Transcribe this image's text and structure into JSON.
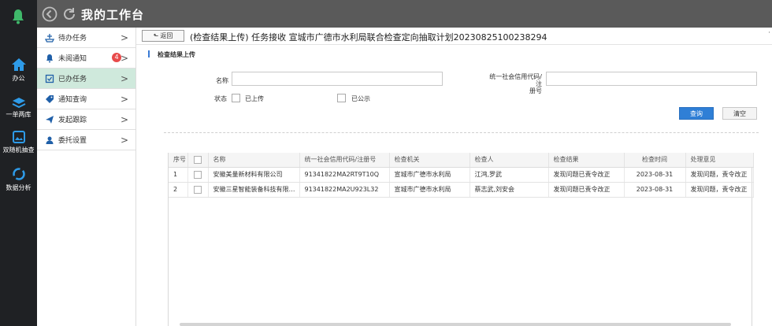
{
  "header": {
    "title": "我的工作台"
  },
  "rail": {
    "items": [
      {
        "label": "办公",
        "icon": "home-icon"
      },
      {
        "label": "一单两库",
        "icon": "layers-icon"
      },
      {
        "label": "双随机抽查",
        "icon": "image-icon"
      },
      {
        "label": "数据分析",
        "icon": "refresh-circle-icon"
      }
    ]
  },
  "sidebar": {
    "items": [
      {
        "label": "待办任务",
        "icon": "ship-icon"
      },
      {
        "label": "未阅通知",
        "icon": "bell-icon",
        "badge": "4"
      },
      {
        "label": "已办任务",
        "icon": "checklist-icon",
        "active": true
      },
      {
        "label": "通知查询",
        "icon": "tag-icon"
      },
      {
        "label": "发起跟踪",
        "icon": "send-icon"
      },
      {
        "label": "委托设置",
        "icon": "user-icon"
      }
    ]
  },
  "breadcrumb": {
    "back_label": "返回",
    "text": "(检查结果上传) 任务接收 宣城市广德市水利局联合检查定向抽取计划20230825100238294"
  },
  "section": {
    "title": "检查结果上传"
  },
  "form": {
    "name_label": "名称",
    "name_value": "",
    "credit_label_line1": "统一社会信用代码/注",
    "credit_label_line2": "册号",
    "credit_value": "",
    "status_label": "状态",
    "opt_uploaded": "已上传",
    "opt_published": "已公示",
    "query_btn": "查询",
    "clear_btn": "清空"
  },
  "table": {
    "headers": [
      "序号",
      "",
      "名称",
      "统一社会信用代码/注册号",
      "检查机关",
      "检查人",
      "检查结果",
      "检查时间",
      "处理意见"
    ],
    "rows": [
      [
        "1",
        "",
        "安徽美量新材料有限公司",
        "91341822MA2RT9T10Q",
        "宣城市广德市水利局",
        "江鸿,罗武",
        "发现问题已责令改正",
        "2023-08-31",
        "发现问题，责令改正"
      ],
      [
        "2",
        "",
        "安徽三星智能装备科技有限公司",
        "91341822MA2U923L32",
        "宣城市广德市水利局",
        "蔡志武,刘安会",
        "发现问题已责令改正",
        "2023-08-31",
        "发现问题，责令改正"
      ]
    ]
  },
  "colors": {
    "accent": "#2f7fd6",
    "active_bg": "#cfe9dc",
    "rail_bg": "#1f2124",
    "header_bg": "#5a5a5a"
  }
}
